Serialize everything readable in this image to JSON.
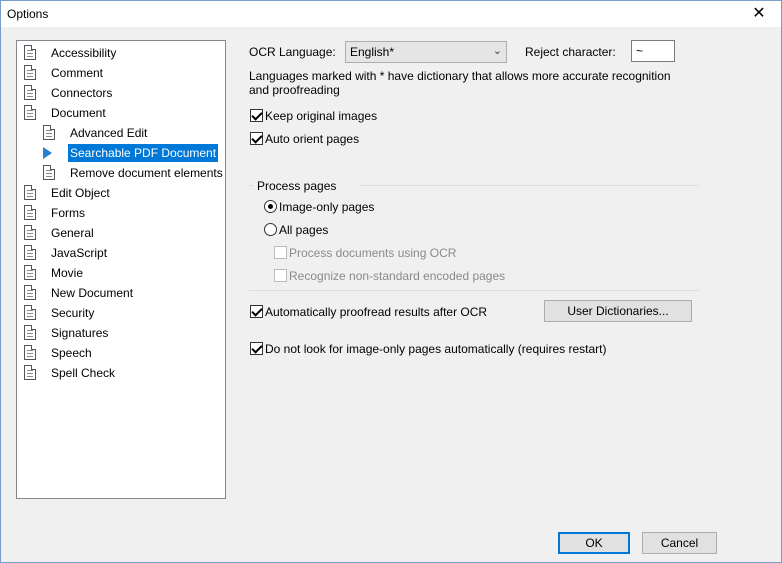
{
  "window": {
    "title": "Options",
    "close_glyph": "✕"
  },
  "tree": {
    "items": [
      {
        "label": "Accessibility",
        "level": 0
      },
      {
        "label": "Comment",
        "level": 0
      },
      {
        "label": "Connectors",
        "level": 0
      },
      {
        "label": "Document",
        "level": 0
      },
      {
        "label": "Advanced Edit",
        "level": 1
      },
      {
        "label": "Searchable PDF Document",
        "level": 1,
        "selected": true
      },
      {
        "label": "Remove document elements",
        "level": 1
      },
      {
        "label": "Edit Object",
        "level": 0
      },
      {
        "label": "Forms",
        "level": 0
      },
      {
        "label": "General",
        "level": 0
      },
      {
        "label": "JavaScript",
        "level": 0
      },
      {
        "label": "Movie",
        "level": 0
      },
      {
        "label": "New Document",
        "level": 0
      },
      {
        "label": "Security",
        "level": 0
      },
      {
        "label": "Signatures",
        "level": 0
      },
      {
        "label": "Speech",
        "level": 0
      },
      {
        "label": "Spell Check",
        "level": 0
      }
    ]
  },
  "ocr": {
    "language_label": "OCR Language:",
    "language_value": "English*",
    "reject_label": "Reject character:",
    "reject_value": "~",
    "note": "Languages marked with * have dictionary that allows more accurate recognition and proofreading"
  },
  "options": {
    "keep_original_images": "Keep original images",
    "auto_orient": "Auto orient pages"
  },
  "process_pages": {
    "group_label": "Process pages",
    "image_only": "Image-only pages",
    "all_pages": "All pages",
    "process_ocr": "Process documents using OCR",
    "recognize_nonstandard": "Recognize non-standard encoded pages"
  },
  "proofread": {
    "label": "Automatically proofread results after OCR",
    "dictionaries_button": "User Dictionaries..."
  },
  "no_look": {
    "label": "Do not look for image-only pages automatically (requires restart)"
  },
  "buttons": {
    "ok": "OK",
    "cancel": "Cancel"
  }
}
